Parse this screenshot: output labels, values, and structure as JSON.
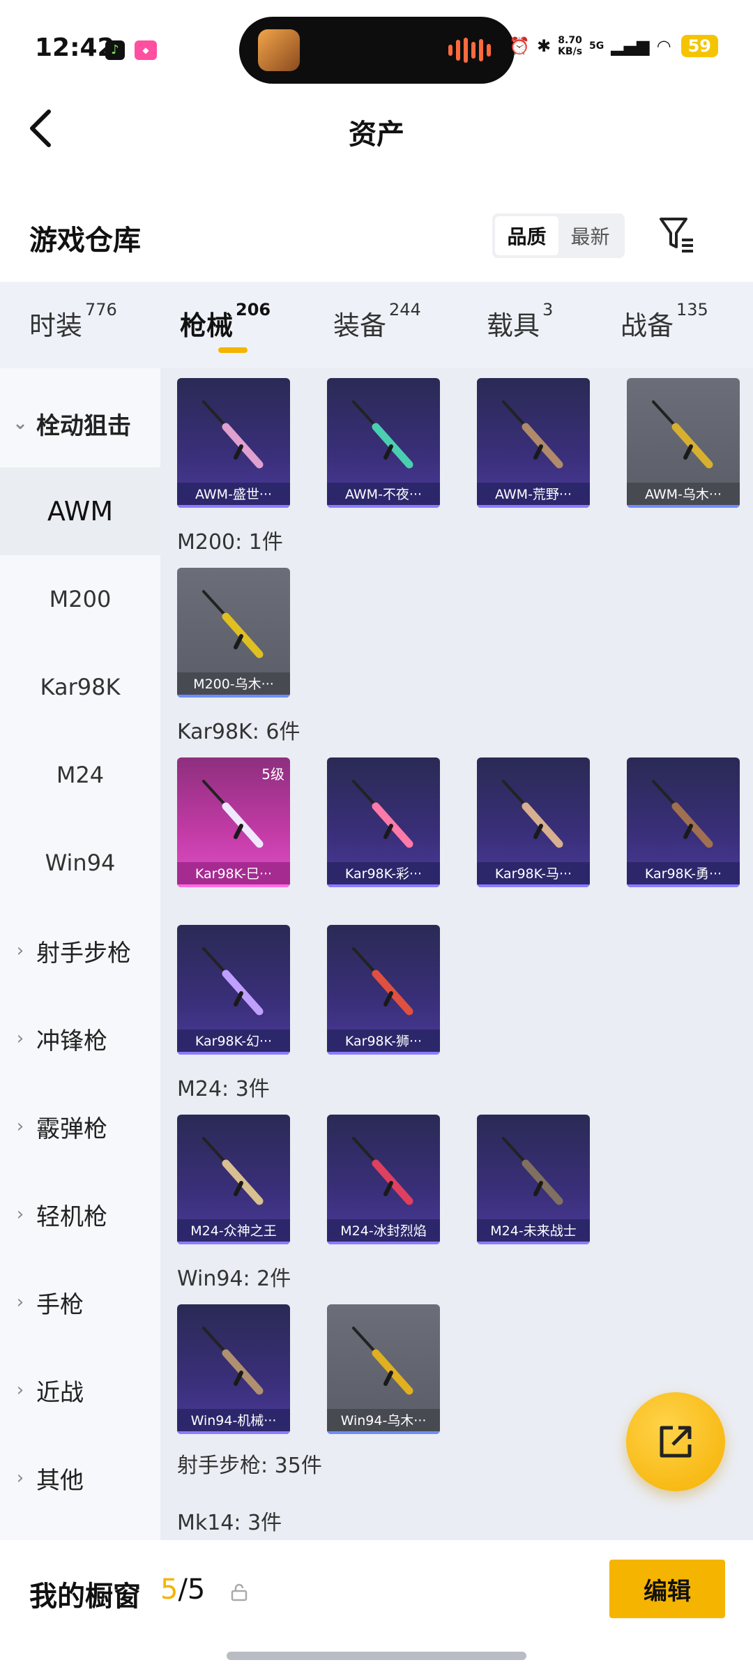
{
  "status": {
    "time": "12:42",
    "net_speed_value": "8.70",
    "net_speed_unit": "KB/s",
    "signal_label": "5G",
    "battery": "59"
  },
  "header": {
    "title": "资产",
    "section_title": "游戏仓库",
    "sort_options": [
      "品质",
      "最新"
    ],
    "sort_active": "品质"
  },
  "tabs": [
    {
      "label": "时装",
      "count": "776"
    },
    {
      "label": "枪械",
      "count": "206"
    },
    {
      "label": "装备",
      "count": "244"
    },
    {
      "label": "载具",
      "count": "3"
    },
    {
      "label": "战备",
      "count": "135"
    }
  ],
  "active_tab": "枪械",
  "sidebar": [
    {
      "label": "栓动狙击",
      "type": "category",
      "expanded": true
    },
    {
      "label": "AWM",
      "type": "sub",
      "active": true
    },
    {
      "label": "M200",
      "type": "sub"
    },
    {
      "label": "Kar98K",
      "type": "sub"
    },
    {
      "label": "M24",
      "type": "sub"
    },
    {
      "label": "Win94",
      "type": "sub"
    },
    {
      "label": "射手步枪",
      "type": "category"
    },
    {
      "label": "冲锋枪",
      "type": "category"
    },
    {
      "label": "霰弹枪",
      "type": "category"
    },
    {
      "label": "轻机枪",
      "type": "category"
    },
    {
      "label": "手枪",
      "type": "category"
    },
    {
      "label": "近战",
      "type": "category"
    },
    {
      "label": "其他",
      "type": "category"
    }
  ],
  "groups": {
    "awm": {
      "items": [
        {
          "name": "AWM-盛世···",
          "style": "purple",
          "color": "#e0a0d0"
        },
        {
          "name": "AWM-不夜···",
          "style": "purple",
          "color": "#4ad0b0"
        },
        {
          "name": "AWM-荒野···",
          "style": "purple",
          "color": "#b08a6a"
        },
        {
          "name": "AWM-乌木···",
          "style": "gray",
          "color": "#d8b030"
        }
      ]
    },
    "m200": {
      "label": "M200: 1件",
      "items": [
        {
          "name": "M200-乌木···",
          "style": "gray",
          "color": "#e0c020"
        }
      ]
    },
    "kar98k": {
      "label": "Kar98K: 6件",
      "items": [
        {
          "name": "Kar98K-巳···",
          "style": "pink",
          "color": "#f0e8ff",
          "badge": "5级"
        },
        {
          "name": "Kar98K-彩···",
          "style": "purple",
          "color": "#ff7aa8"
        },
        {
          "name": "Kar98K-马···",
          "style": "purple",
          "color": "#d8b090"
        },
        {
          "name": "Kar98K-勇···",
          "style": "purple",
          "color": "#a07050"
        },
        {
          "name": "Kar98K-幻···",
          "style": "purple",
          "color": "#c0a0ff"
        },
        {
          "name": "Kar98K-狮···",
          "style": "purple",
          "color": "#e05040"
        }
      ]
    },
    "m24": {
      "label": "M24: 3件",
      "items": [
        {
          "name": "M24-众神之王",
          "style": "purple",
          "color": "#d8c090"
        },
        {
          "name": "M24-冰封烈焰",
          "style": "purple",
          "color": "#e04060"
        },
        {
          "name": "M24-未来战士",
          "style": "purple",
          "color": "#807060"
        }
      ]
    },
    "win94": {
      "label": "Win94: 2件",
      "items": [
        {
          "name": "Win94-机械···",
          "style": "purple",
          "color": "#b09070"
        },
        {
          "name": "Win94-乌木···",
          "style": "gray",
          "color": "#e0b020"
        }
      ]
    },
    "marksman": {
      "label": "射手步枪: 35件"
    },
    "mk14": {
      "label": "Mk14: 3件"
    }
  },
  "showcase": {
    "label": "我的橱窗",
    "current": "5",
    "total": "/5",
    "edit_label": "编辑"
  },
  "colors": {
    "accent": "#f5b400",
    "tab_bg": "#eef2f8",
    "content_bg": "#eaedf3"
  }
}
